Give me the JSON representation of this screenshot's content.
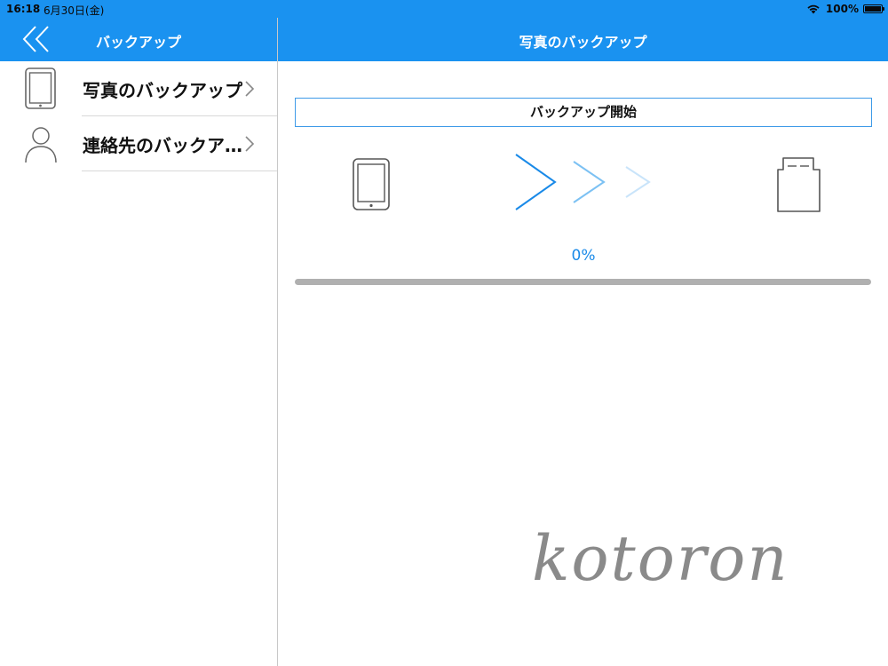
{
  "status_bar": {
    "time": "16:18",
    "date": "6月30日(金)",
    "battery_percent": "100%",
    "battery_level": 1.0
  },
  "sidebar": {
    "title": "バックアップ",
    "items": [
      {
        "label": "写真のバックアップ",
        "icon": "tablet-icon"
      },
      {
        "label": "連絡先のバックア…",
        "icon": "person-icon"
      }
    ]
  },
  "main": {
    "title": "写真のバックアップ",
    "start_button_label": "バックアップ開始",
    "progress_text": "0%",
    "progress": 0.0,
    "source_icon": "tablet-icon",
    "destination_icon": "sd-card-icon",
    "watermark_text": "kotoron"
  },
  "colors": {
    "accent": "#1a92f0",
    "progress_text": "#1a8ae8",
    "progress_track": "#b0b0b0",
    "start_button_border": "#3f9be8",
    "arrow_colors": [
      "#1a8ae8",
      "#7cc1f3",
      "#c9e4fa"
    ]
  }
}
